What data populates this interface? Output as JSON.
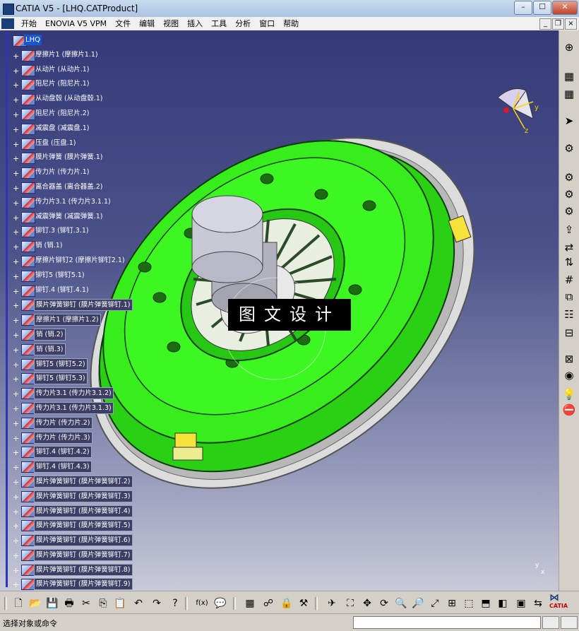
{
  "window": {
    "title": "CATIA V5 - [LHQ.CATProduct]",
    "min": "–",
    "max": "☐",
    "close": "✕"
  },
  "menu": [
    "开始",
    "ENOVIA V5 VPM",
    "文件",
    "编辑",
    "视图",
    "插入",
    "工具",
    "分析",
    "窗口",
    "帮助"
  ],
  "tree": {
    "root": "LHQ",
    "items": [
      "摩擦片1 (摩擦片1.1)",
      "从动片 (从动片.1)",
      "阻尼片 (阻尼片.1)",
      "从动盘毂 (从动盘毂.1)",
      "阻尼片 (阻尼片.2)",
      "减震盘 (减震盘.1)",
      "压盘 (压盘.1)",
      "膜片弹簧 (膜片弹簧.1)",
      "传力片 (传力片.1)",
      "离合器盖 (离合器盖.2)",
      "传力片3.1 (传力片3.1.1)",
      "减震弹簧 (减震弹簧.1)",
      "铆钉.3 (铆钉.3.1)",
      "销 (销.1)",
      "摩擦片铆钉2 (摩擦片铆钉2.1)",
      "铆钉5 (铆钉5.1)",
      "铆钉.4 (铆钉.4.1)",
      "膜片弹簧铆钉 (膜片弹簧铆钉.1)",
      "摩擦片1 (摩擦片1.2)",
      "销 (销.2)",
      "销 (销.3)",
      "铆钉5 (铆钉5.2)",
      "铆钉5 (铆钉5.3)",
      "传力片3.1 (传力片3.1.2)",
      "传力片3.1 (传力片3.1.3)",
      "传力片 (传力片.2)",
      "传力片 (传力片.3)",
      "铆钉.4 (铆钉.4.2)",
      "铆钉.4 (铆钉.4.3)",
      "膜片弹簧铆钉 (膜片弹簧铆钉.2)",
      "膜片弹簧铆钉 (膜片弹簧铆钉.3)",
      "膜片弹簧铆钉 (膜片弹簧铆钉.4)",
      "膜片弹簧铆钉 (膜片弹簧铆钉.5)",
      "膜片弹簧铆钉 (膜片弹簧铆钉.6)",
      "膜片弹簧铆钉 (膜片弹簧铆钉.7)",
      "膜片弹簧铆钉 (膜片弹簧铆钉.8)",
      "膜片弹簧铆钉 (膜片弹簧铆钉.9)"
    ]
  },
  "compass": {
    "x": "x",
    "y": "y",
    "z": "z"
  },
  "watermark": "图文设计",
  "bottom_axis": {
    "y": "y",
    "x": "x"
  },
  "status": {
    "prompt": "选择对象或命令",
    "command_value": ""
  },
  "colors": {
    "viewport_top": "#343a78",
    "viewport_bottom": "#c8cad8",
    "model_green": "#37ee1c",
    "tree_selected": "#1656d0"
  },
  "toolbar_icons": [
    "new-icon",
    "open-icon",
    "save-icon",
    "print-icon",
    "cut-icon",
    "copy-icon",
    "paste-icon",
    "undo-icon",
    "redo-icon",
    "whats-this-icon",
    "formula-icon",
    "comment-icon",
    "table-icon",
    "tree-icon",
    "lock-icon",
    "tools-icon",
    "fly-icon",
    "fit-all-icon",
    "pan-icon",
    "rotate-icon",
    "zoom-in-icon",
    "zoom-out-icon",
    "normal-view-icon",
    "multi-view-icon",
    "iso-view-icon",
    "view-mode-icon",
    "shading-icon",
    "hide-show-icon",
    "swap-visible-icon"
  ],
  "right_icons": [
    "compass-icon",
    "product-icon",
    "part-icon",
    "select-icon",
    "part-design-icon",
    "new-component-icon",
    "new-product-icon",
    "new-part-icon",
    "existing-component-icon",
    "replace-icon",
    "reorder-icon",
    "numbering-icon",
    "multi-instantiate-icon",
    "bom-icon",
    "constraint-icon",
    "fix-icon",
    "hide-icon",
    "light-icon",
    "clash-icon"
  ],
  "catia_brand": "CATIA"
}
